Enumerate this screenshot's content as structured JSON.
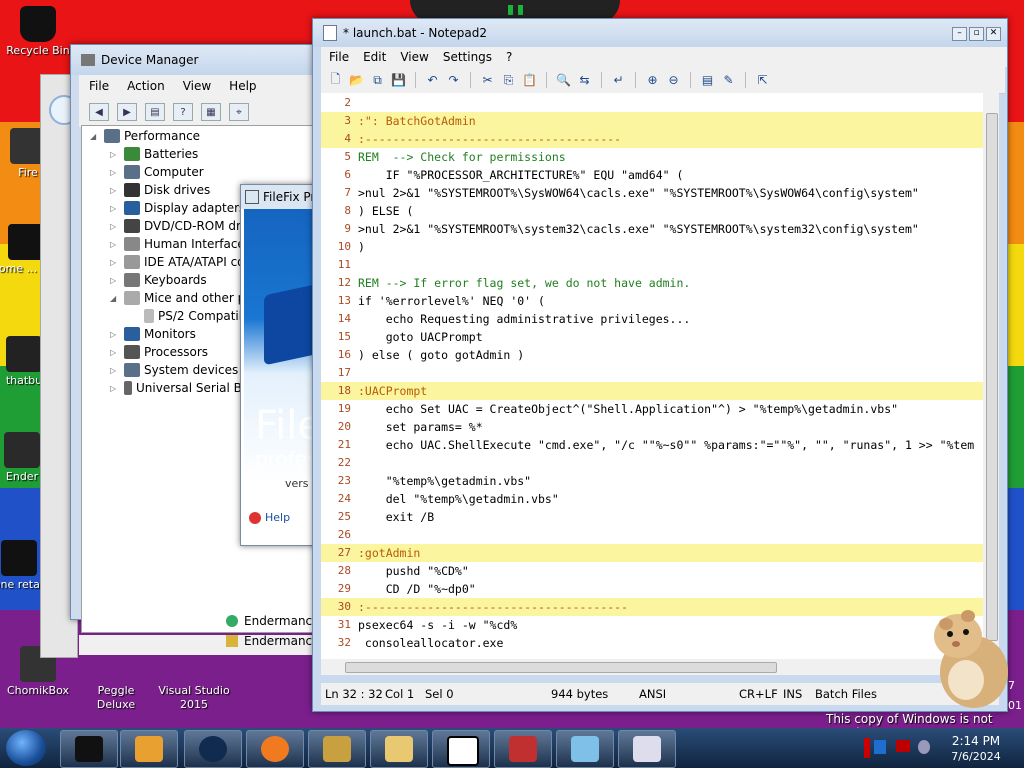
{
  "desktop": {
    "icons": [
      {
        "label": "Recycle Bin",
        "icon": "recycle-bin-icon"
      },
      {
        "label": "Fire",
        "icon": "firefox-icon"
      },
      {
        "label": "some ... ran",
        "icon": "shortcut-icon"
      },
      {
        "label": "thatbu",
        "icon": "shortcut-icon"
      },
      {
        "label": "Ender",
        "icon": "minecraft-icon"
      },
      {
        "label": "none retard",
        "icon": "folder-icon"
      },
      {
        "label": "ChomikBox",
        "icon": "chomikbox-icon"
      },
      {
        "label": "Peggle Deluxe",
        "icon": "peggle-icon"
      },
      {
        "label": "Visual Studio 2015",
        "icon": "visual-studio-icon"
      }
    ],
    "activation_watermark": "This copy of Windows is not genuine"
  },
  "device_manager": {
    "title": "Device Manager",
    "menu": [
      "File",
      "Action",
      "View",
      "Help"
    ],
    "tree": [
      {
        "label": "Performance",
        "level": 0,
        "expanded": true
      },
      {
        "label": "Batteries",
        "level": 1
      },
      {
        "label": "Computer",
        "level": 1
      },
      {
        "label": "Disk drives",
        "level": 1
      },
      {
        "label": "Display adapters",
        "level": 1
      },
      {
        "label": "DVD/CD-ROM driv",
        "level": 1
      },
      {
        "label": "Human Interface D",
        "level": 1
      },
      {
        "label": "IDE ATA/ATAPI co",
        "level": 1
      },
      {
        "label": "Keyboards",
        "level": 1
      },
      {
        "label": "Mice and other po",
        "level": 1,
        "expanded": true
      },
      {
        "label": "PS/2 Compatib",
        "level": 2
      },
      {
        "label": "Monitors",
        "level": 1
      },
      {
        "label": "Processors",
        "level": 1
      },
      {
        "label": "System devices",
        "level": 1
      },
      {
        "label": "Universal Serial Bu",
        "level": 1
      }
    ]
  },
  "filefix": {
    "title": "FileFix Pr",
    "brand": "File",
    "brand_sub": "profes",
    "version": "vers",
    "help": "Help"
  },
  "behind_items": [
    "Endermanch",
    "Endermanch"
  ],
  "notepad": {
    "title": "* launch.bat - Notepad2",
    "menu": [
      "File",
      "Edit",
      "View",
      "Settings",
      "?"
    ],
    "lines": [
      {
        "n": "2",
        "text": "",
        "hl": false,
        "cls": ""
      },
      {
        "n": "3",
        "text": ":\": BatchGotAdmin",
        "hl": true,
        "cls": "k-label"
      },
      {
        "n": "4",
        "text": ":-------------------------------------",
        "hl": true,
        "cls": "k-label"
      },
      {
        "n": "5",
        "text": "REM  --> Check for permissions",
        "hl": false,
        "cls": "k-rem"
      },
      {
        "n": "6",
        "text": "    IF \"%PROCESSOR_ARCHITECTURE%\" EQU \"amd64\" (",
        "hl": false,
        "cls": ""
      },
      {
        "n": "7",
        "text": ">nul 2>&1 \"%SYSTEMROOT%\\SysWOW64\\cacls.exe\" \"%SYSTEMROOT%\\SysWOW64\\config\\system\"",
        "hl": false,
        "cls": ""
      },
      {
        "n": "8",
        "text": ") ELSE (",
        "hl": false,
        "cls": ""
      },
      {
        "n": "9",
        "text": ">nul 2>&1 \"%SYSTEMROOT%\\system32\\cacls.exe\" \"%SYSTEMROOT%\\system32\\config\\system\"",
        "hl": false,
        "cls": ""
      },
      {
        "n": "10",
        "text": ")",
        "hl": false,
        "cls": ""
      },
      {
        "n": "11",
        "text": "",
        "hl": false,
        "cls": ""
      },
      {
        "n": "12",
        "text": "REM --> If error flag set, we do not have admin.",
        "hl": false,
        "cls": "k-rem"
      },
      {
        "n": "13",
        "text": "if '%errorlevel%' NEQ '0' (",
        "hl": false,
        "cls": ""
      },
      {
        "n": "14",
        "text": "    echo Requesting administrative privileges...",
        "hl": false,
        "cls": ""
      },
      {
        "n": "15",
        "text": "    goto UACPrompt",
        "hl": false,
        "cls": ""
      },
      {
        "n": "16",
        "text": ") else ( goto gotAdmin )",
        "hl": false,
        "cls": ""
      },
      {
        "n": "17",
        "text": "",
        "hl": false,
        "cls": ""
      },
      {
        "n": "18",
        "text": ":UACPrompt",
        "hl": true,
        "cls": "k-label"
      },
      {
        "n": "19",
        "text": "    echo Set UAC = CreateObject^(\"Shell.Application\"^) > \"%temp%\\getadmin.vbs\"",
        "hl": false,
        "cls": ""
      },
      {
        "n": "20",
        "text": "    set params= %*",
        "hl": false,
        "cls": ""
      },
      {
        "n": "21",
        "text": "    echo UAC.ShellExecute \"cmd.exe\", \"/c \"\"%~s0\"\" %params:\"=\"\"%\", \"\", \"runas\", 1 >> \"%tem",
        "hl": false,
        "cls": ""
      },
      {
        "n": "22",
        "text": "",
        "hl": false,
        "cls": ""
      },
      {
        "n": "23",
        "text": "    \"%temp%\\getadmin.vbs\"",
        "hl": false,
        "cls": ""
      },
      {
        "n": "24",
        "text": "    del \"%temp%\\getadmin.vbs\"",
        "hl": false,
        "cls": ""
      },
      {
        "n": "25",
        "text": "    exit /B",
        "hl": false,
        "cls": ""
      },
      {
        "n": "26",
        "text": "",
        "hl": false,
        "cls": ""
      },
      {
        "n": "27",
        "text": ":gotAdmin",
        "hl": true,
        "cls": "k-label"
      },
      {
        "n": "28",
        "text": "    pushd \"%CD%\"",
        "hl": false,
        "cls": ""
      },
      {
        "n": "29",
        "text": "    CD /D \"%~dp0\"",
        "hl": false,
        "cls": ""
      },
      {
        "n": "30",
        "text": ":--------------------------------------",
        "hl": true,
        "cls": "k-label"
      },
      {
        "n": "31",
        "text": "psexec64 -s -i -w \"%cd%",
        "hl": false,
        "cls": ""
      },
      {
        "n": "32",
        "text": " consoleallocator.exe",
        "hl": false,
        "cls": ""
      }
    ],
    "status": {
      "position": "Ln 32 : 32",
      "col": "Col 1",
      "sel": "Sel 0",
      "size": "944 bytes",
      "encoding": "ANSI",
      "eol": "CR+LF",
      "ins": "INS",
      "scheme": "Batch Files"
    }
  },
  "taskbar": {
    "time": "2:14 PM",
    "date": "7/6/2024",
    "edge_time": "7",
    "edge_date": "01"
  }
}
